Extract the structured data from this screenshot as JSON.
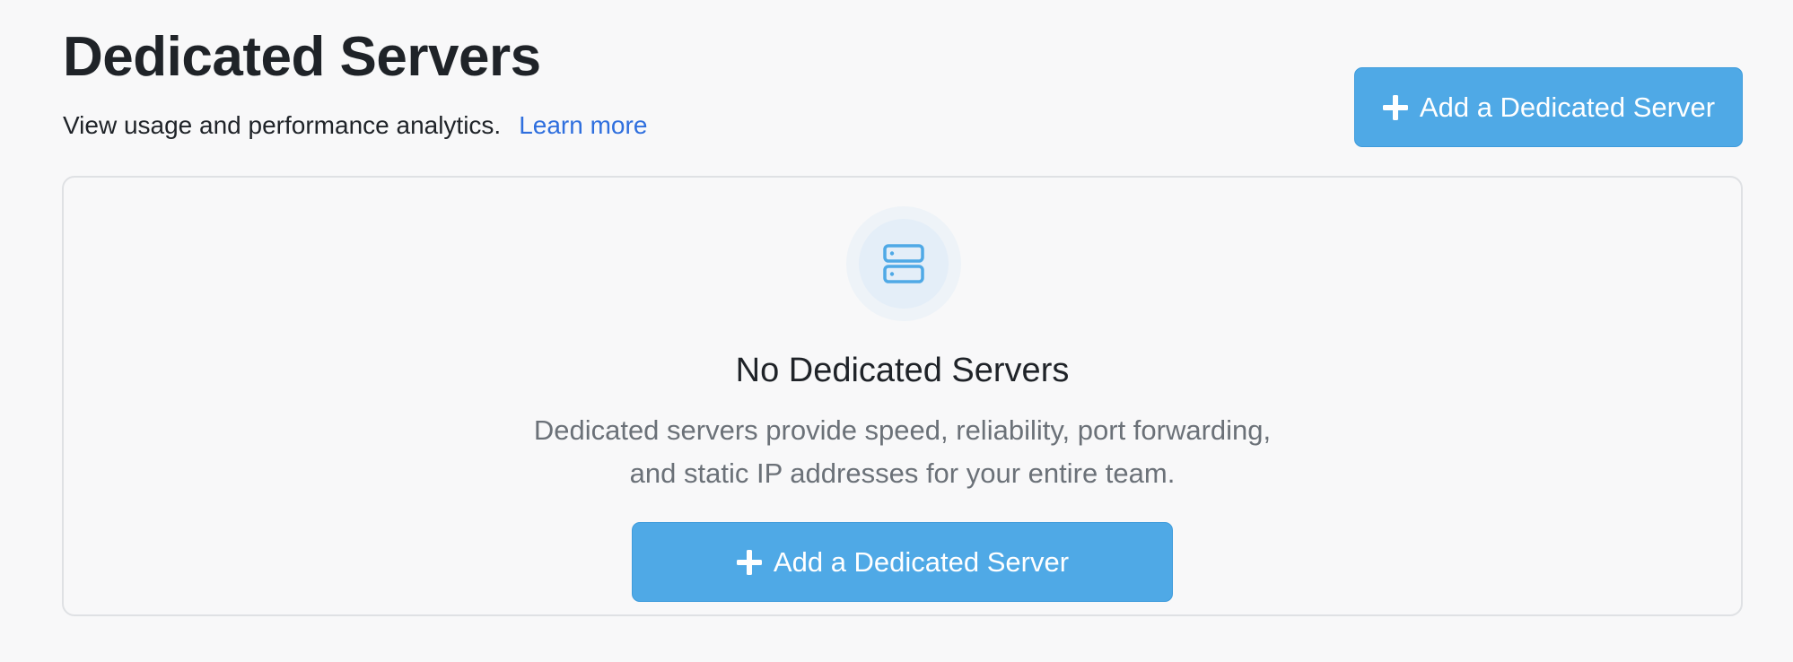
{
  "header": {
    "title": "Dedicated Servers",
    "subtitle": "View usage and performance analytics.",
    "learn_more": "Learn more",
    "add_button_label": "Add a Dedicated Server"
  },
  "empty_state": {
    "icon": "server-icon",
    "title": "No Dedicated Servers",
    "description_line1": "Dedicated servers provide speed, reliability, port forwarding,",
    "description_line2": "and static IP addresses for your entire team.",
    "add_button_label": "Add a Dedicated Server"
  },
  "colors": {
    "accent": "#4fa9e6",
    "link": "#2f6fde",
    "background": "#f8f8f9"
  }
}
